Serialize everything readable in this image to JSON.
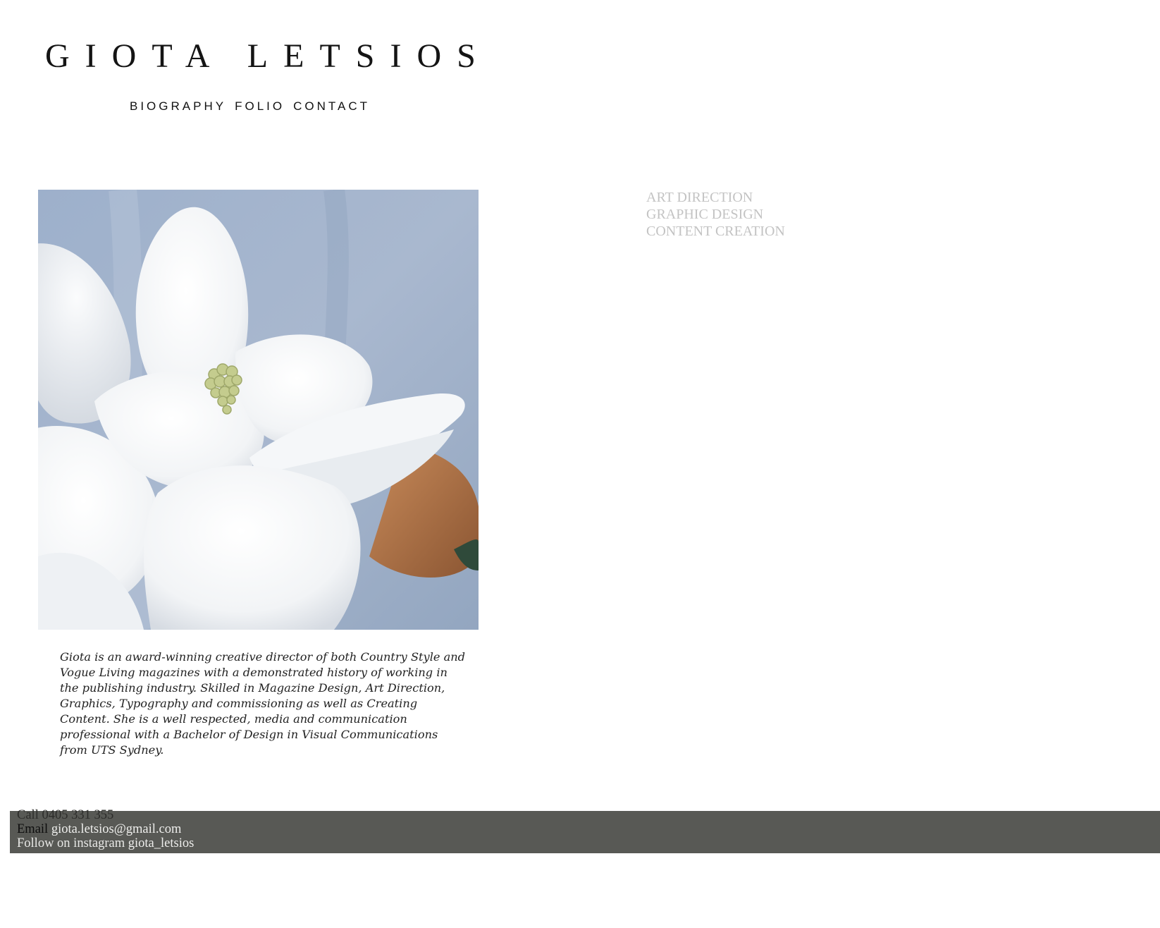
{
  "header": {
    "site_title": "GIOTA LETSIOS",
    "nav": [
      {
        "label": "BIOGRAPHY"
      },
      {
        "label": "FOLIO"
      },
      {
        "label": "CONTACT"
      }
    ]
  },
  "hero": {
    "image_description": "magnolia-flower-photo"
  },
  "services": [
    "ART DIRECTION",
    "GRAPHIC DESIGN",
    "CONTENT CREATION"
  ],
  "bio": {
    "text": "Giota is an award-winning creative director of both Country Style and Vogue Living magazines with a demonstrated history of working in the publishing industry. Skilled in Magazine Design, Art Direction, Graphics, Typography and commissioning as well as Creating Content. She is a well respected, media and communication professional with a Bachelor of Design in Visual Communications from UTS Sydney."
  },
  "footer": {
    "call_label": "Call",
    "call_value": "0405 331 355",
    "email_label": "Email",
    "email_value": "giota.letsios@gmail.com",
    "instagram_label": "Follow on instagram",
    "instagram_value": "giota_letsios",
    "background_color": "#585955"
  }
}
